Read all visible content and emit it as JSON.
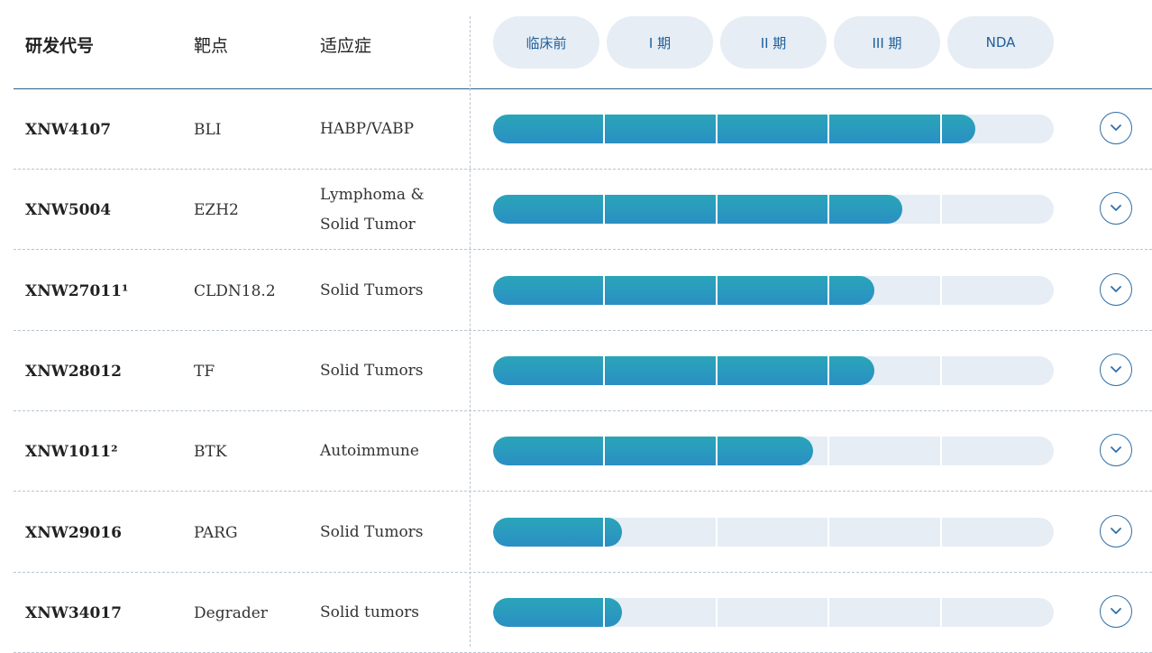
{
  "header": {
    "code_label": "研发代号",
    "target_label": "靶点",
    "indication_label": "适应症",
    "phases": [
      "临床前",
      "I 期",
      "II 期",
      "III 期",
      "NDA"
    ]
  },
  "rows": [
    {
      "code": "XNW4107",
      "target": "BLI",
      "indication": "HABP/VABP",
      "progress": 0.86
    },
    {
      "code": "XNW5004",
      "target": "EZH2",
      "indication": "Lymphoma & Solid Tumor",
      "progress": 0.73
    },
    {
      "code": "XNW27011¹",
      "target": "CLDN18.2",
      "indication": "Solid Tumors",
      "progress": 0.68
    },
    {
      "code": "XNW28012",
      "target": "TF",
      "indication": "Solid Tumors",
      "progress": 0.68
    },
    {
      "code": "XNW1011²",
      "target": "BTK",
      "indication": "Autoimmune",
      "progress": 0.57
    },
    {
      "code": "XNW29016",
      "target": "PARG",
      "indication": "Solid Tumors",
      "progress": 0.23
    },
    {
      "code": "XNW34017",
      "target": "Degrader",
      "indication": "Solid tumors",
      "progress": 0.23
    }
  ],
  "icons": {
    "expand": "chevron-down-icon"
  },
  "colors": {
    "accent": "#2a8fc3",
    "track": "#e6edf5",
    "pill_text": "#1d5f9a"
  }
}
